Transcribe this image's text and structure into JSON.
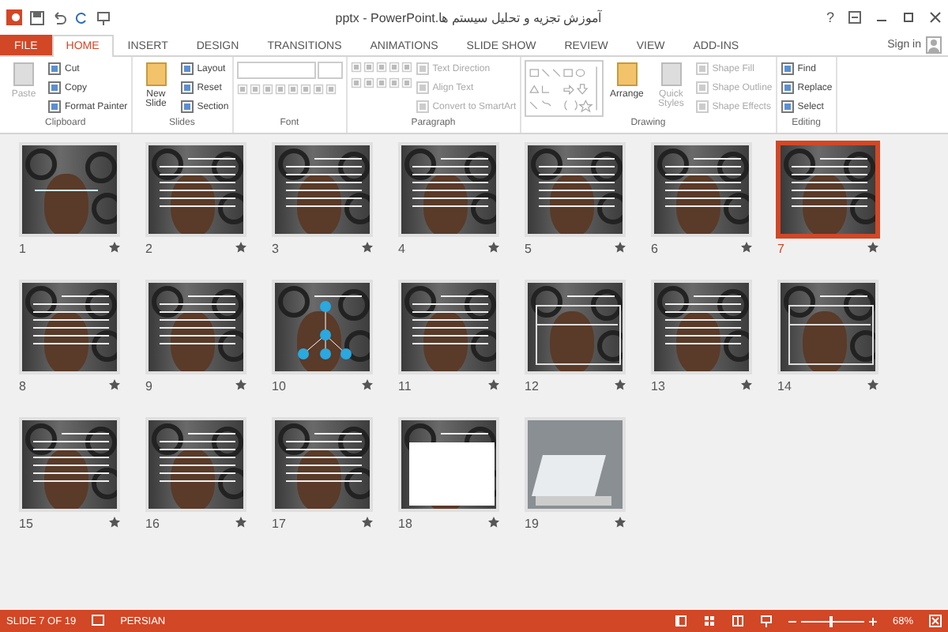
{
  "window": {
    "title": "آموزش تجزیه و تحلیل سیستم ها.pptx - PowerPoint",
    "help": "?"
  },
  "tabs": [
    {
      "label": "FILE",
      "kind": "file",
      "selected": false
    },
    {
      "label": "HOME",
      "kind": "tab",
      "selected": true
    },
    {
      "label": "INSERT",
      "kind": "tab",
      "selected": false
    },
    {
      "label": "DESIGN",
      "kind": "tab",
      "selected": false
    },
    {
      "label": "TRANSITIONS",
      "kind": "tab",
      "selected": false
    },
    {
      "label": "ANIMATIONS",
      "kind": "tab",
      "selected": false
    },
    {
      "label": "SLIDE SHOW",
      "kind": "tab",
      "selected": false
    },
    {
      "label": "REVIEW",
      "kind": "tab",
      "selected": false
    },
    {
      "label": "VIEW",
      "kind": "tab",
      "selected": false
    },
    {
      "label": "ADD-INS",
      "kind": "tab",
      "selected": false
    }
  ],
  "account": {
    "label": "Sign in"
  },
  "ribbon": [
    {
      "label": "Clipboard",
      "kind": "basic",
      "large": [
        {
          "label": "Paste",
          "disabled": true
        }
      ],
      "small": [
        {
          "label": "Cut",
          "disabled": false
        },
        {
          "label": "Copy",
          "disabled": false
        },
        {
          "label": "Format Painter",
          "disabled": false
        }
      ]
    },
    {
      "label": "Slides",
      "kind": "basic",
      "large": [
        {
          "label": "New Slide",
          "disabled": false
        }
      ],
      "small": [
        {
          "label": "Layout",
          "disabled": false
        },
        {
          "label": "Reset",
          "disabled": false
        },
        {
          "label": "Section",
          "disabled": false
        }
      ]
    },
    {
      "label": "Font",
      "kind": "font"
    },
    {
      "label": "Paragraph",
      "kind": "paragraph",
      "small": [
        {
          "label": "Text Direction",
          "disabled": true
        },
        {
          "label": "Align Text",
          "disabled": true
        },
        {
          "label": "Convert to SmartArt",
          "disabled": true
        }
      ]
    },
    {
      "label": "Drawing",
      "kind": "drawing",
      "large": [
        {
          "label": "Arrange",
          "disabled": false
        },
        {
          "label": "Quick Styles",
          "disabled": true
        }
      ],
      "small": [
        {
          "label": "Shape Fill",
          "disabled": true
        },
        {
          "label": "Shape Outline",
          "disabled": true
        },
        {
          "label": "Shape Effects",
          "disabled": true
        }
      ]
    },
    {
      "label": "Editing",
      "kind": "basic",
      "small": [
        {
          "label": "Find",
          "disabled": false
        },
        {
          "label": "Replace",
          "disabled": false
        },
        {
          "label": "Select",
          "disabled": false
        }
      ]
    }
  ],
  "slides": [
    {
      "number": "1",
      "kind": "title",
      "selected": false
    },
    {
      "number": "2",
      "kind": "text",
      "selected": false
    },
    {
      "number": "3",
      "kind": "text",
      "selected": false
    },
    {
      "number": "4",
      "kind": "text",
      "selected": false
    },
    {
      "number": "5",
      "kind": "text",
      "selected": false
    },
    {
      "number": "6",
      "kind": "text",
      "selected": false
    },
    {
      "number": "7",
      "kind": "text",
      "selected": true
    },
    {
      "number": "8",
      "kind": "text",
      "selected": false
    },
    {
      "number": "9",
      "kind": "text",
      "selected": false
    },
    {
      "number": "10",
      "kind": "diagram",
      "selected": false
    },
    {
      "number": "11",
      "kind": "text",
      "selected": false
    },
    {
      "number": "12",
      "kind": "table",
      "selected": false
    },
    {
      "number": "13",
      "kind": "text",
      "selected": false
    },
    {
      "number": "14",
      "kind": "table",
      "selected": false
    },
    {
      "number": "15",
      "kind": "text",
      "selected": false
    },
    {
      "number": "16",
      "kind": "text",
      "selected": false
    },
    {
      "number": "17",
      "kind": "text",
      "selected": false
    },
    {
      "number": "18",
      "kind": "form",
      "selected": false
    },
    {
      "number": "19",
      "kind": "photo",
      "selected": false
    }
  ],
  "status_bar": {
    "slide": "SLIDE 7 OF 19",
    "language": "PERSIAN",
    "zoom": "68%",
    "zoom_slider": {
      "level": 0.45
    }
  }
}
